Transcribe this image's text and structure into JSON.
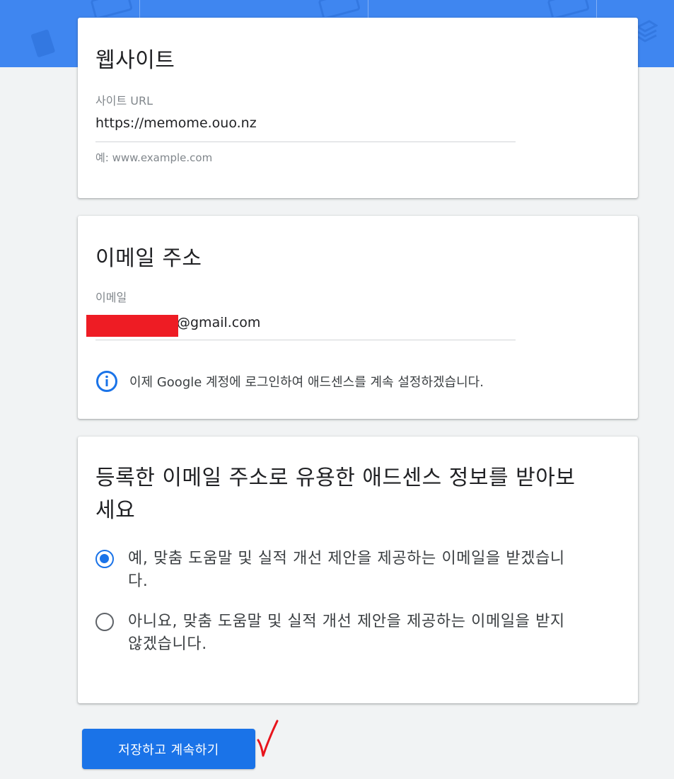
{
  "colors": {
    "header": "#3f86f0",
    "accent": "#1a73e8",
    "page_background": "#f1f3f4",
    "card_background": "#ffffff",
    "redaction": "#ee1c24",
    "annotation_check": "#e8141c"
  },
  "website_section": {
    "title": "웹사이트",
    "url_label": "사이트 URL",
    "url_value": "https://memome.ouo.nz",
    "url_hint": "예: www.example.com"
  },
  "email_section": {
    "title": "이메일 주소",
    "email_label": "이메일",
    "email_value": "@gmail.com",
    "info_icon": "info-icon",
    "info_text": "이제 Google 계정에 로그인하여 애드센스를 계속 설정하겠습니다."
  },
  "optin_section": {
    "title_line1": "등록한 이메일 주소로 유용한 애드센스 정보를 받아보",
    "title_line2": "세요",
    "option_yes_line1": "예, 맞춤 도움말 및 실적 개선 제안을 제공하는 이메일을 받겠습니",
    "option_yes_line2": "다.",
    "option_no_line1": "아니요, 맞춤 도움말 및 실적 개선 제안을 제공하는 이메일을 받지",
    "option_no_line2": "않겠습니다.",
    "selected": "yes"
  },
  "actions": {
    "save_label": "저장하고 계속하기"
  }
}
